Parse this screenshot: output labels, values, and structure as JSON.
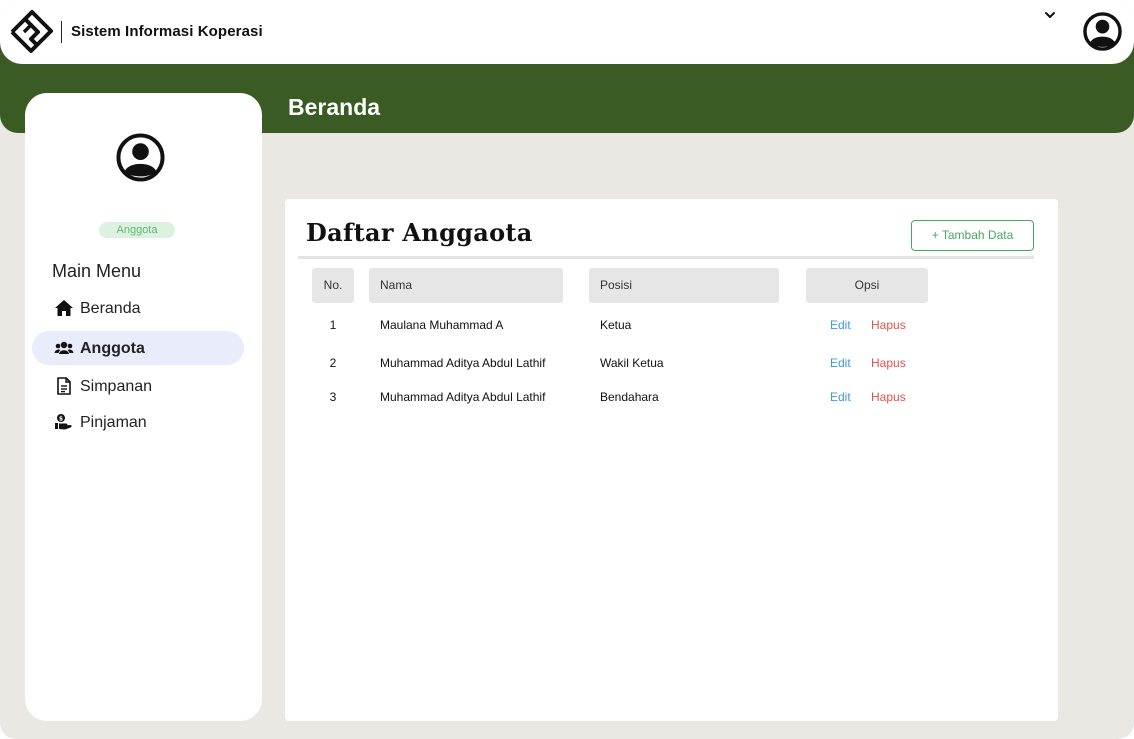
{
  "header": {
    "app_title": "Sistem Informasi Koperasi",
    "page_title": "Beranda"
  },
  "sidebar": {
    "role_badge": "Anggota",
    "menu_heading": "Main Menu",
    "items": [
      {
        "label": "Beranda",
        "icon": "home-icon",
        "active": false
      },
      {
        "label": "Anggota",
        "icon": "users-icon",
        "active": true
      },
      {
        "label": "Simpanan",
        "icon": "document-icon",
        "active": false
      },
      {
        "label": "Pinjaman",
        "icon": "hand-money-icon",
        "active": false
      }
    ]
  },
  "main": {
    "card_title": "Daftar Anggaota",
    "add_button": "+ Tambah Data",
    "table": {
      "headers": [
        "No.",
        "Nama",
        "Posisi",
        "Opsi"
      ],
      "rows": [
        {
          "no": "1",
          "nama": "Maulana Muhammad A",
          "posisi": "Ketua",
          "edit": "Edit",
          "delete": "Hapus"
        },
        {
          "no": "2",
          "nama": "Muhammad Aditya Abdul Lathif",
          "posisi": "Wakil Ketua",
          "edit": "Edit",
          "delete": "Hapus"
        },
        {
          "no": "3",
          "nama": "Muhammad Aditya Abdul Lathif",
          "posisi": "Bendahara",
          "edit": "Edit",
          "delete": "Hapus"
        }
      ]
    }
  },
  "colors": {
    "brand_green": "#3b5b25",
    "accent_green": "#47a862",
    "badge_bg": "#dcf1e0",
    "active_menu_bg": "#e8ecfb",
    "edit_link": "#3a9ad9",
    "delete_link": "#e0524f",
    "page_bg": "#ebe8e3"
  }
}
